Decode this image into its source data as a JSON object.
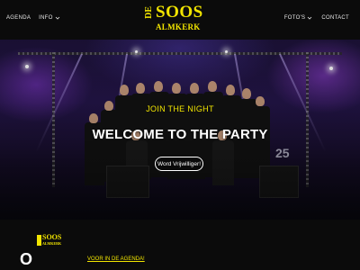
{
  "header": {
    "nav_left": [
      {
        "label": "AGENDA",
        "has_dropdown": false
      },
      {
        "label": "INFO",
        "has_dropdown": true
      }
    ],
    "nav_right": [
      {
        "label": "FOTO'S",
        "has_dropdown": true
      },
      {
        "label": "CONTACT",
        "has_dropdown": false
      }
    ],
    "logo": {
      "de": "DE",
      "name": "SOOS",
      "place": "ALMKERK"
    }
  },
  "hero": {
    "tagline": "JOIN THE NIGHT",
    "title": "WELCOME TO THE PARTY",
    "cta_label": "Word Vrijwilliger!",
    "screen_number": "25"
  },
  "bottom": {
    "logo_name": "SOOS",
    "logo_place": "ALMKERK",
    "big_text": "O",
    "agenda_link": "VOOR IN DE AGENDA!"
  },
  "colors": {
    "accent": "#f2e500",
    "background": "#0b0b0b",
    "stage_purple": "#24154a"
  },
  "icons": {
    "dropdown": "chevron-down-icon"
  }
}
